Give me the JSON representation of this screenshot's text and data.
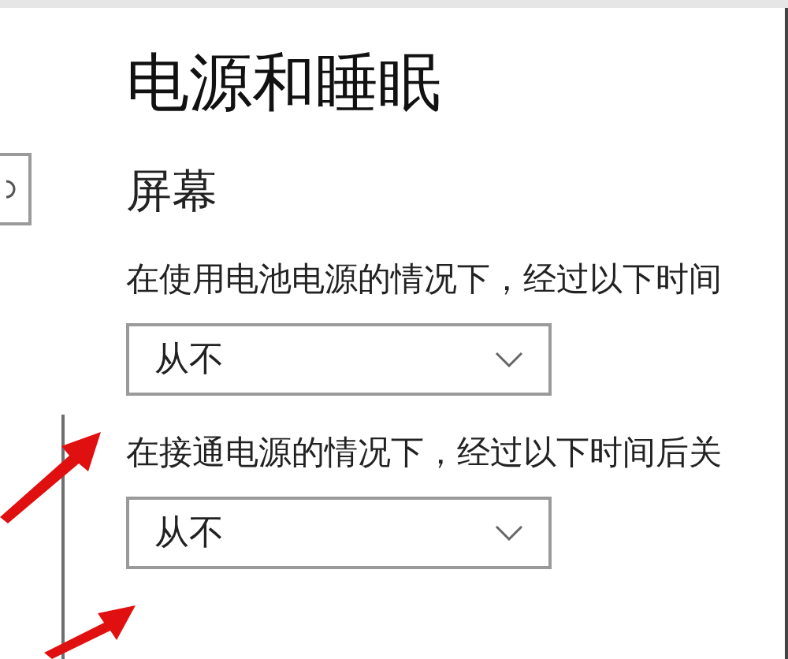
{
  "page_title": "电源和睡眠",
  "section_title": "屏幕",
  "settings": [
    {
      "label": "在使用电池电源的情况下，经过以下时间",
      "value": "从不"
    },
    {
      "label": "在接通电源的情况下，经过以下时间后关",
      "value": "从不"
    }
  ]
}
